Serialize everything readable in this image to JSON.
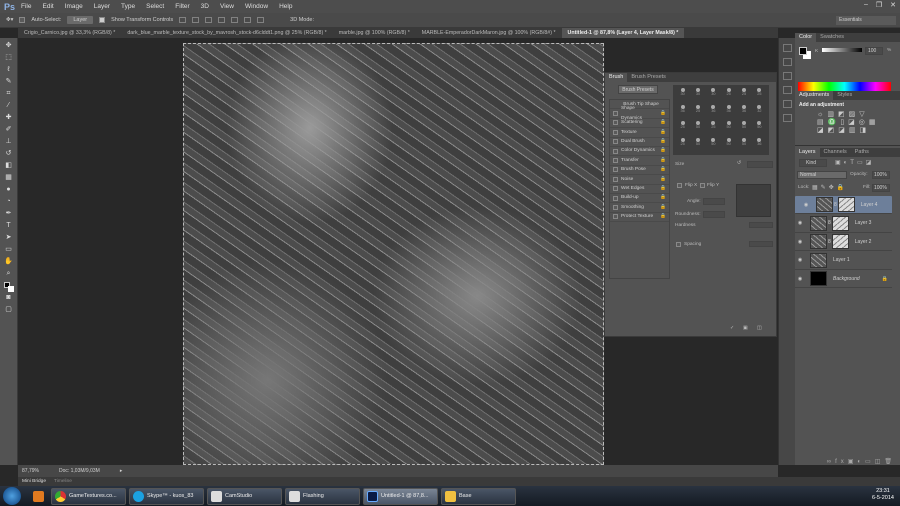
{
  "app": {
    "logo": "Ps",
    "menu": [
      "File",
      "Edit",
      "Image",
      "Layer",
      "Type",
      "Select",
      "Filter",
      "3D",
      "View",
      "Window",
      "Help"
    ],
    "window_buttons": [
      "–",
      "❐",
      "✕"
    ]
  },
  "options": {
    "auto_select_label": "Auto-Select:",
    "auto_select_value": "Layer",
    "show_transform_label": "Show Transform Controls",
    "mode_3d_label": "3D Mode:",
    "workspace": "Essentials"
  },
  "tabs": [
    "Crigio_Carnico.jpg @ 33,3% (RGB/8) *",
    "dark_blue_marble_texture_stock_by_mavrosh_stock-d6clddt1.png @ 25% (RGB/8) *",
    "marble.jpg @ 100% (RGB/8) *",
    "MARBLE-EmperadorDarkMaron.jpg @ 100% (RGB/8#) *",
    "Untitled-1 @ 87,8% (Layer 4, Layer Mask/8) *"
  ],
  "brush_panel": {
    "tabs": [
      "Brush",
      "Brush Presets"
    ],
    "presets_button": "Brush Presets",
    "tip_shape": "Brush Tip Shape",
    "options": [
      "Shape Dynamics",
      "Scattering",
      "Texture",
      "Dual Brush",
      "Color Dynamics",
      "Transfer",
      "Brush Pose",
      "Noise",
      "Wet Edges",
      "Build-up",
      "Smoothing",
      "Protect Texture"
    ],
    "sizes": [
      "30",
      "30",
      "30",
      "25",
      "25",
      "25",
      "36",
      "25",
      "36",
      "36",
      "36",
      "32",
      "25",
      "50",
      "25",
      "50",
      "50",
      "50",
      "25",
      "50",
      "50",
      "50",
      "50",
      "36"
    ],
    "size_label": "Size",
    "flip_x": "Flip X",
    "flip_y": "Flip Y",
    "angle": "Angle:",
    "roundness": "Roundness:",
    "hardness": "Hardness",
    "spacing": "Spacing"
  },
  "color_panel": {
    "tabs": [
      "Color",
      "Swatches"
    ],
    "channel": "K",
    "value": "100",
    "unit": "%"
  },
  "adjustments": {
    "tabs": [
      "Adjustments",
      "Styles"
    ],
    "heading": "Add an adjustment"
  },
  "layers_panel": {
    "tabs": [
      "Layers",
      "Channels",
      "Paths"
    ],
    "filter": "Kind",
    "blend_mode": "Normal",
    "opacity_label": "Opacity:",
    "opacity": "100%",
    "lock_label": "Lock:",
    "fill_label": "Fill:",
    "fill": "100%",
    "layers": [
      {
        "name": "Layer 4",
        "selected": true,
        "mask": true
      },
      {
        "name": "Layer 3",
        "mask": true
      },
      {
        "name": "Layer 2",
        "mask": true
      },
      {
        "name": "Layer 1"
      },
      {
        "name": "Background",
        "locked": true
      }
    ]
  },
  "status": {
    "zoom": "87,79%",
    "doc": "Doc: 1,03M/9,03M"
  },
  "bottom_tabs": [
    "Mini Bridge",
    "Timeline"
  ],
  "taskbar": {
    "items": [
      "GameTextures.co...",
      "Skype™ - kuos_83",
      "CamStudio",
      "Flashing",
      "Untitled-1 @ 87,8...",
      "Base"
    ],
    "time": "23:31",
    "date": "6-5-2014"
  }
}
